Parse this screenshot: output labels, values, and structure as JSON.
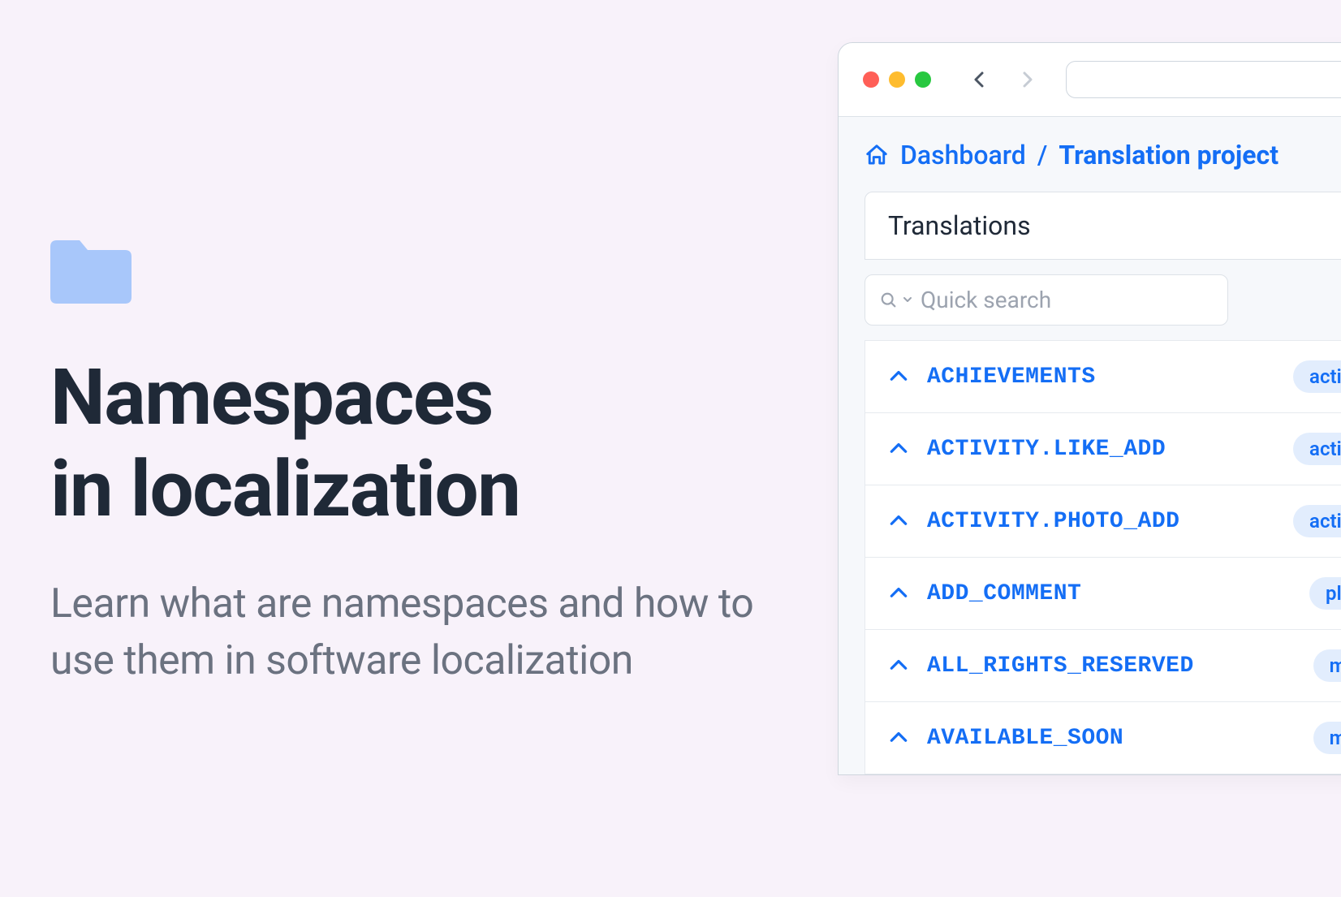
{
  "hero": {
    "title_line1": "Namespaces",
    "title_line2": "in localization",
    "subtitle": "Learn what are namespaces and how to use them in software localization"
  },
  "breadcrumb": {
    "home": "Dashboard",
    "separator": "/",
    "current": "Translation project"
  },
  "tab": {
    "label": "Translations"
  },
  "search": {
    "placeholder": "Quick search"
  },
  "keys": [
    {
      "name": "ACHIEVEMENTS",
      "tag": "activity"
    },
    {
      "name": "ACTIVITY.LIKE_ADD",
      "tag": "activity"
    },
    {
      "name": "ACTIVITY.PHOTO_ADD",
      "tag": "activity"
    },
    {
      "name": "ADD_COMMENT",
      "tag": "place"
    },
    {
      "name": "ALL_RIGHTS_RESERVED",
      "tag": "main"
    },
    {
      "name": "AVAILABLE_SOON",
      "tag": "main"
    }
  ],
  "colors": {
    "accent": "#146ef5",
    "folder": "#a8c7fa",
    "bg": "#f8f2fa"
  }
}
